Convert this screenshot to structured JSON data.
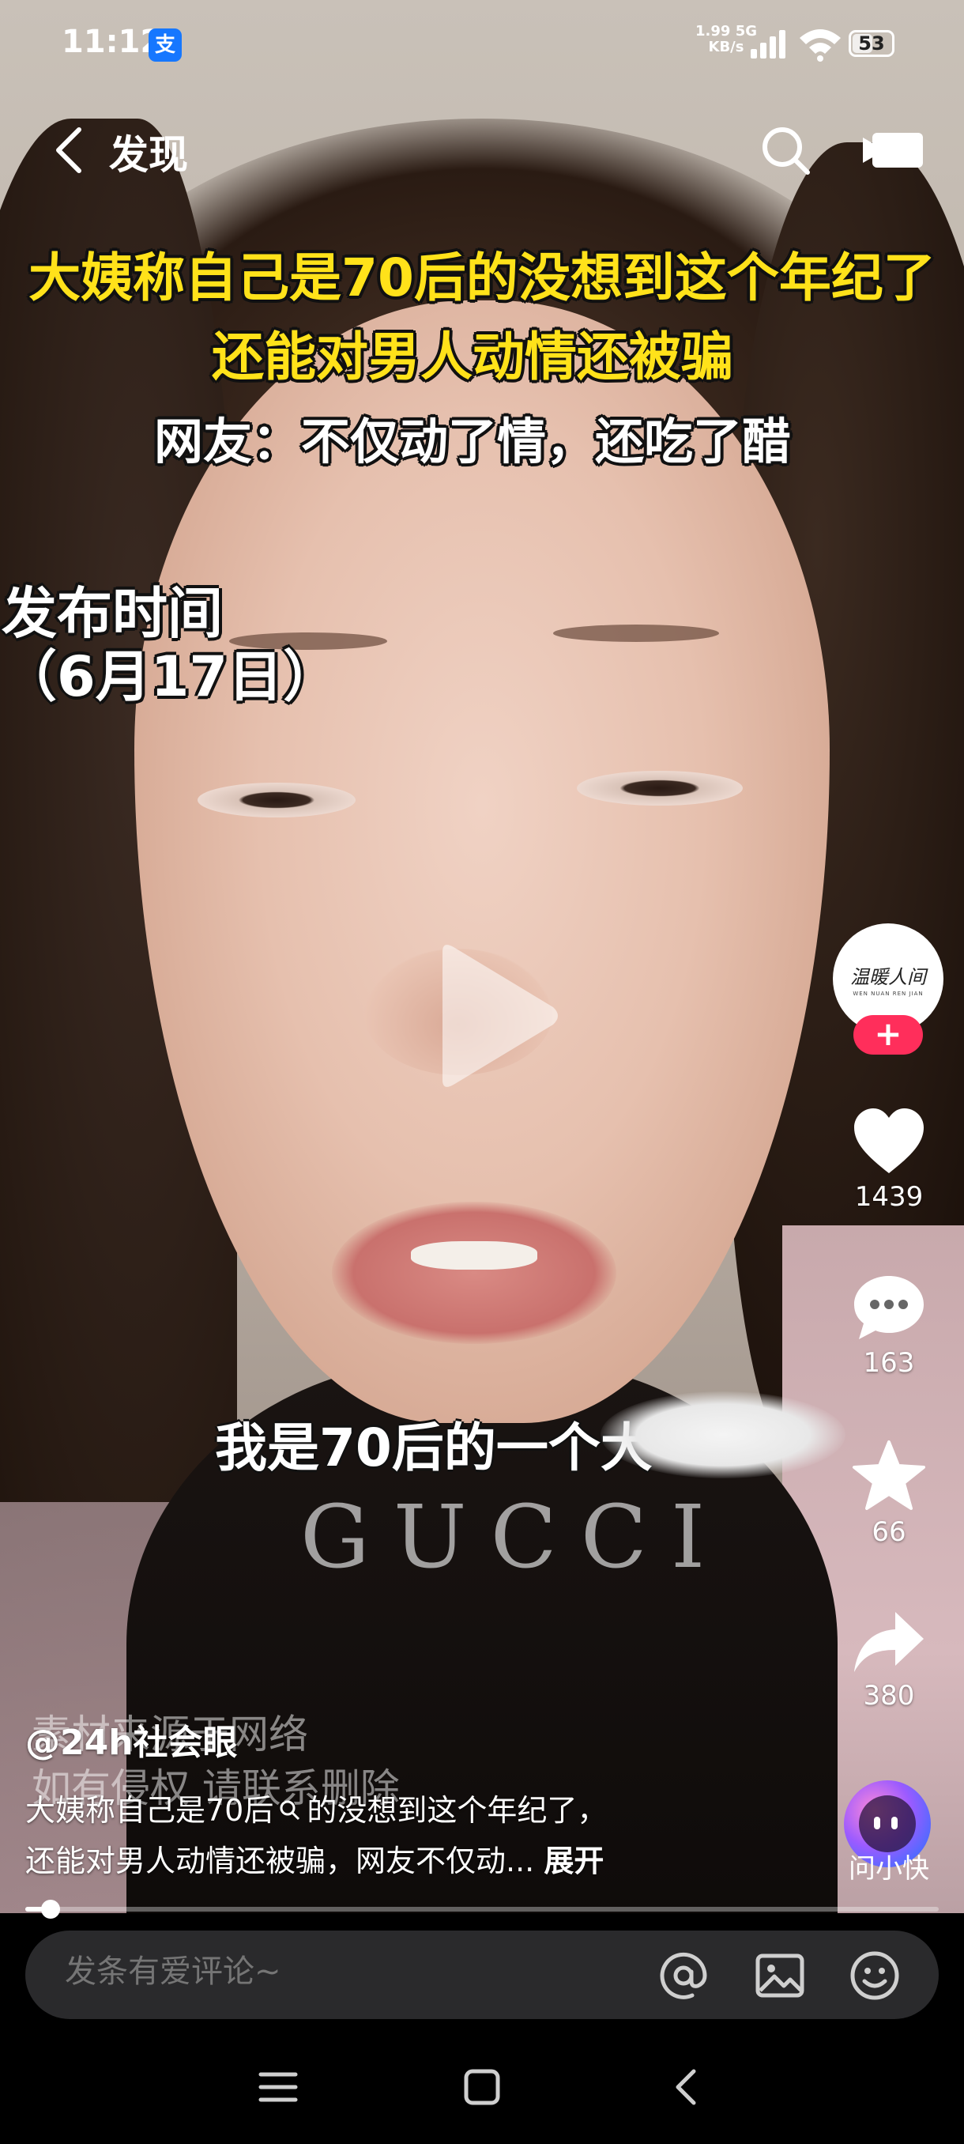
{
  "status_bar": {
    "time": "11:12",
    "app_badge": "支",
    "net_speed": "1.99",
    "net_unit": "KB/s",
    "net_type": "5G",
    "battery": "53"
  },
  "nav": {
    "title": "发现"
  },
  "video": {
    "caption_line1": "大姨称自己是70后的没想到这个年纪了",
    "caption_line2": "还能对男人动情还被骗",
    "caption_line3": "网友：不仅动了情，还吃了醋",
    "publish_label": "发布时间",
    "publish_date": "（6月17日）",
    "spoken_subtitle": "我是70后的一个大",
    "sweater_logo": "GUCCI",
    "watermark_line1": "素材来源于网络",
    "watermark_line2": "如有侵权 请联系删除"
  },
  "rail": {
    "avatar_text": "温暖人间",
    "avatar_subtext": "WEN NUAN REN JIAN",
    "follow_icon": "+",
    "likes": "1439",
    "comments": "163",
    "favorites": "66",
    "shares": "380",
    "ai_label": "问小快"
  },
  "post": {
    "author": "@24h社会眼",
    "description_line1": "大姨称自己是70后",
    "description_line1b": "的没想到这个年纪了，",
    "description_line2": "还能对男人动情还被骗，网友不仅动...",
    "expand": "展开",
    "progress": 0.028
  },
  "comment_bar": {
    "placeholder": "发条有爱评论~"
  },
  "icons": {
    "back": "chevron-left-icon",
    "search": "search-icon",
    "camera": "camera-icon",
    "like": "heart-icon",
    "comment": "chat-bubble-icon",
    "favorite": "star-icon",
    "share": "share-arrow-icon",
    "mention": "at-icon",
    "image": "image-icon",
    "emoji": "emoji-icon"
  },
  "colors": {
    "caption_yellow": "#ffe21a",
    "follow_pink": "#ff2e5b",
    "alipay_blue": "#1677ff"
  }
}
